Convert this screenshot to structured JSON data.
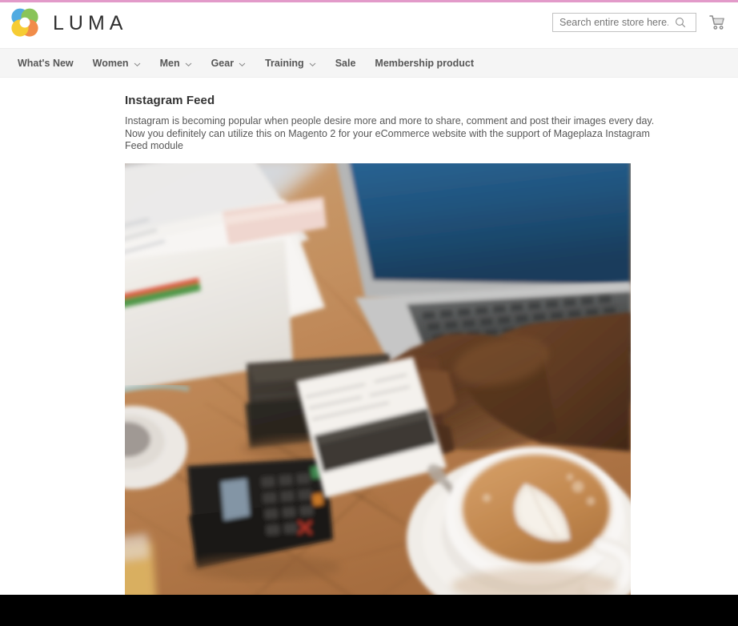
{
  "theme": {
    "accent_strip_color": "#e29ac9",
    "nav_background": "#f5f5f5",
    "text_color": "#575757",
    "bottom_bar_color": "#000000"
  },
  "header": {
    "logo_name": "luma-logo",
    "brand": "LUMA",
    "search": {
      "placeholder": "Search entire store here...",
      "value": "",
      "icon": "search-icon"
    },
    "cart": {
      "icon": "cart-icon",
      "label": "My Cart"
    }
  },
  "nav": {
    "items": [
      {
        "label": "What's New",
        "has_dropdown": false
      },
      {
        "label": "Women",
        "has_dropdown": true
      },
      {
        "label": "Men",
        "has_dropdown": true
      },
      {
        "label": "Gear",
        "has_dropdown": true
      },
      {
        "label": "Training",
        "has_dropdown": true
      },
      {
        "label": "Sale",
        "has_dropdown": false
      },
      {
        "label": "Membership product",
        "has_dropdown": false
      }
    ]
  },
  "main": {
    "feed": {
      "title": "Instagram Feed",
      "description": "Instagram is becoming popular when people desire more and more to share, comment and post their images every day. Now you definitely can utilize this on Magento 2 for your eCommerce website with the support of Mageplaza Instagram Feed module",
      "photo_alt": "Hand holding a credit card over a wooden desk with laptop, card reader, wallet, notebook and cappuccino"
    }
  }
}
